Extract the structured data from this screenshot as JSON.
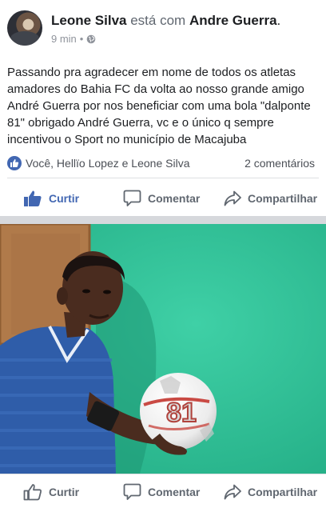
{
  "post": {
    "author": "Leone Silva",
    "connector": "está com",
    "tagged": "Andre Guerra",
    "period": ".",
    "time": "9 min",
    "dot": "•",
    "text": "Passando pra agradecer em nome de todos os atletas amadores do Bahia FC da volta ao nosso grande amigo André Guerra por nos beneficiar com uma bola \"dalponte 81\" obrigado André Guerra, vc e o único q sempre incentivou o Sport no município de Macajuba"
  },
  "reactions": {
    "names": "Você, Hellïo Lopez e Leone Silva",
    "comments": "2 comentários"
  },
  "actions_top": {
    "like": "Curtir",
    "comment": "Comentar",
    "share": "Compartilhar"
  },
  "photo": {
    "ball_number": "81"
  },
  "actions_bottom": {
    "like": "Curtir",
    "comment": "Comentar",
    "share": "Compartilhar"
  },
  "colors": {
    "brand_blue": "#4267b2",
    "wall_green": "#33c29a",
    "separator": "#d6d8dc"
  },
  "icons": {
    "like": "thumbs-up-icon",
    "comment": "speech-bubble-icon",
    "share": "share-arrow-icon",
    "privacy": "globe-icon"
  }
}
